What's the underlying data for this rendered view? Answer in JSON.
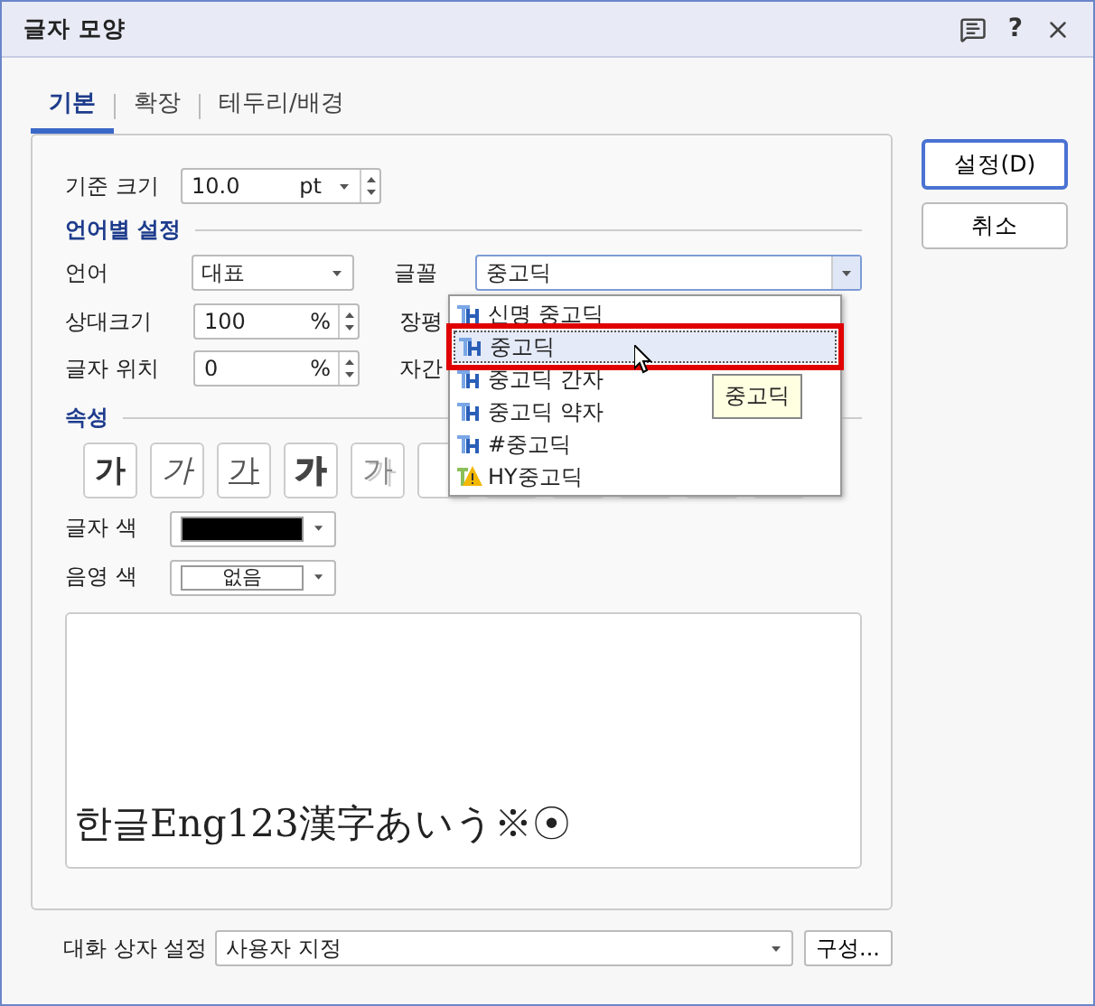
{
  "window": {
    "title": "글자 모양",
    "help": "?"
  },
  "tabs": [
    {
      "label": "기본",
      "selected": true
    },
    {
      "label": "확장",
      "selected": false
    },
    {
      "label": "테두리/배경",
      "selected": false
    }
  ],
  "actions": [
    {
      "label": "설정(D)",
      "kind": "primary"
    },
    {
      "label": "취소",
      "kind": "normal"
    }
  ],
  "base_size": {
    "label": "기준 크기",
    "value": "10.0",
    "unit": "pt"
  },
  "language_section": {
    "title": "언어별 설정",
    "language": {
      "label": "언어",
      "value": "대표"
    },
    "font": {
      "label": "글꼴",
      "value": "중고딕",
      "expanded": true
    },
    "relative_size": {
      "label": "상대크기",
      "value": "100",
      "unit": "%"
    },
    "position": {
      "label": "글자 위치",
      "value": "0",
      "unit": "%"
    },
    "width_label": "장평",
    "spacing_label": "자간"
  },
  "font_list": [
    {
      "name": "신명 중고딕",
      "kind": "truetype",
      "selected": false,
      "annotated": false
    },
    {
      "name": "중고딕",
      "kind": "truetype",
      "selected": true,
      "annotated": true
    },
    {
      "name": "중고딕 간자",
      "kind": "truetype",
      "selected": false,
      "annotated": false
    },
    {
      "name": "중고딕 약자",
      "kind": "truetype",
      "selected": false,
      "annotated": false
    },
    {
      "name": "#중고딕",
      "kind": "truetype",
      "selected": false,
      "annotated": false
    },
    {
      "name": "HY중고딕",
      "kind": "warning",
      "selected": false,
      "annotated": false
    }
  ],
  "tooltip": "중고딕",
  "attributes_section": {
    "title": "속성",
    "buttons": [
      {
        "glyph": "가",
        "kind": "bold"
      },
      {
        "glyph": "가",
        "kind": "italic"
      },
      {
        "glyph": "가",
        "kind": "underline"
      },
      {
        "glyph": "가",
        "kind": "outline"
      },
      {
        "glyph": "가",
        "kind": "shadow"
      }
    ],
    "text_color": {
      "label": "글자 색",
      "color": "#000000"
    },
    "shade_color": {
      "label": "음영 색",
      "value": "없음"
    }
  },
  "preview": {
    "text": "한글Eng123漢字あいう※☉"
  },
  "footer": {
    "label": "대화 상자 설정",
    "value": "사용자 지정",
    "button": "구성..."
  }
}
